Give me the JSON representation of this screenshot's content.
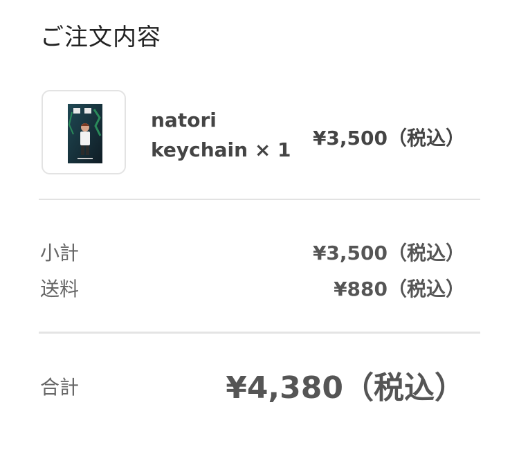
{
  "order": {
    "title": "ご注文内容",
    "item": {
      "thumbnail_icon": "product-keychain-image",
      "name": "natori keychain × 1",
      "price": "¥3,500（税込）"
    },
    "summary": {
      "subtotal_label": "小計",
      "subtotal_value": "¥3,500（税込）",
      "shipping_label": "送料",
      "shipping_value": "¥880（税込）"
    },
    "total": {
      "label": "合計",
      "value": "¥4,380（税込）"
    }
  },
  "colors": {
    "text_primary": "#222222",
    "text_secondary": "#666666",
    "divider": "#e2e2e2",
    "thumbnail_bg": "#1d3340",
    "thumbnail_accent": "#2a8a5a"
  }
}
